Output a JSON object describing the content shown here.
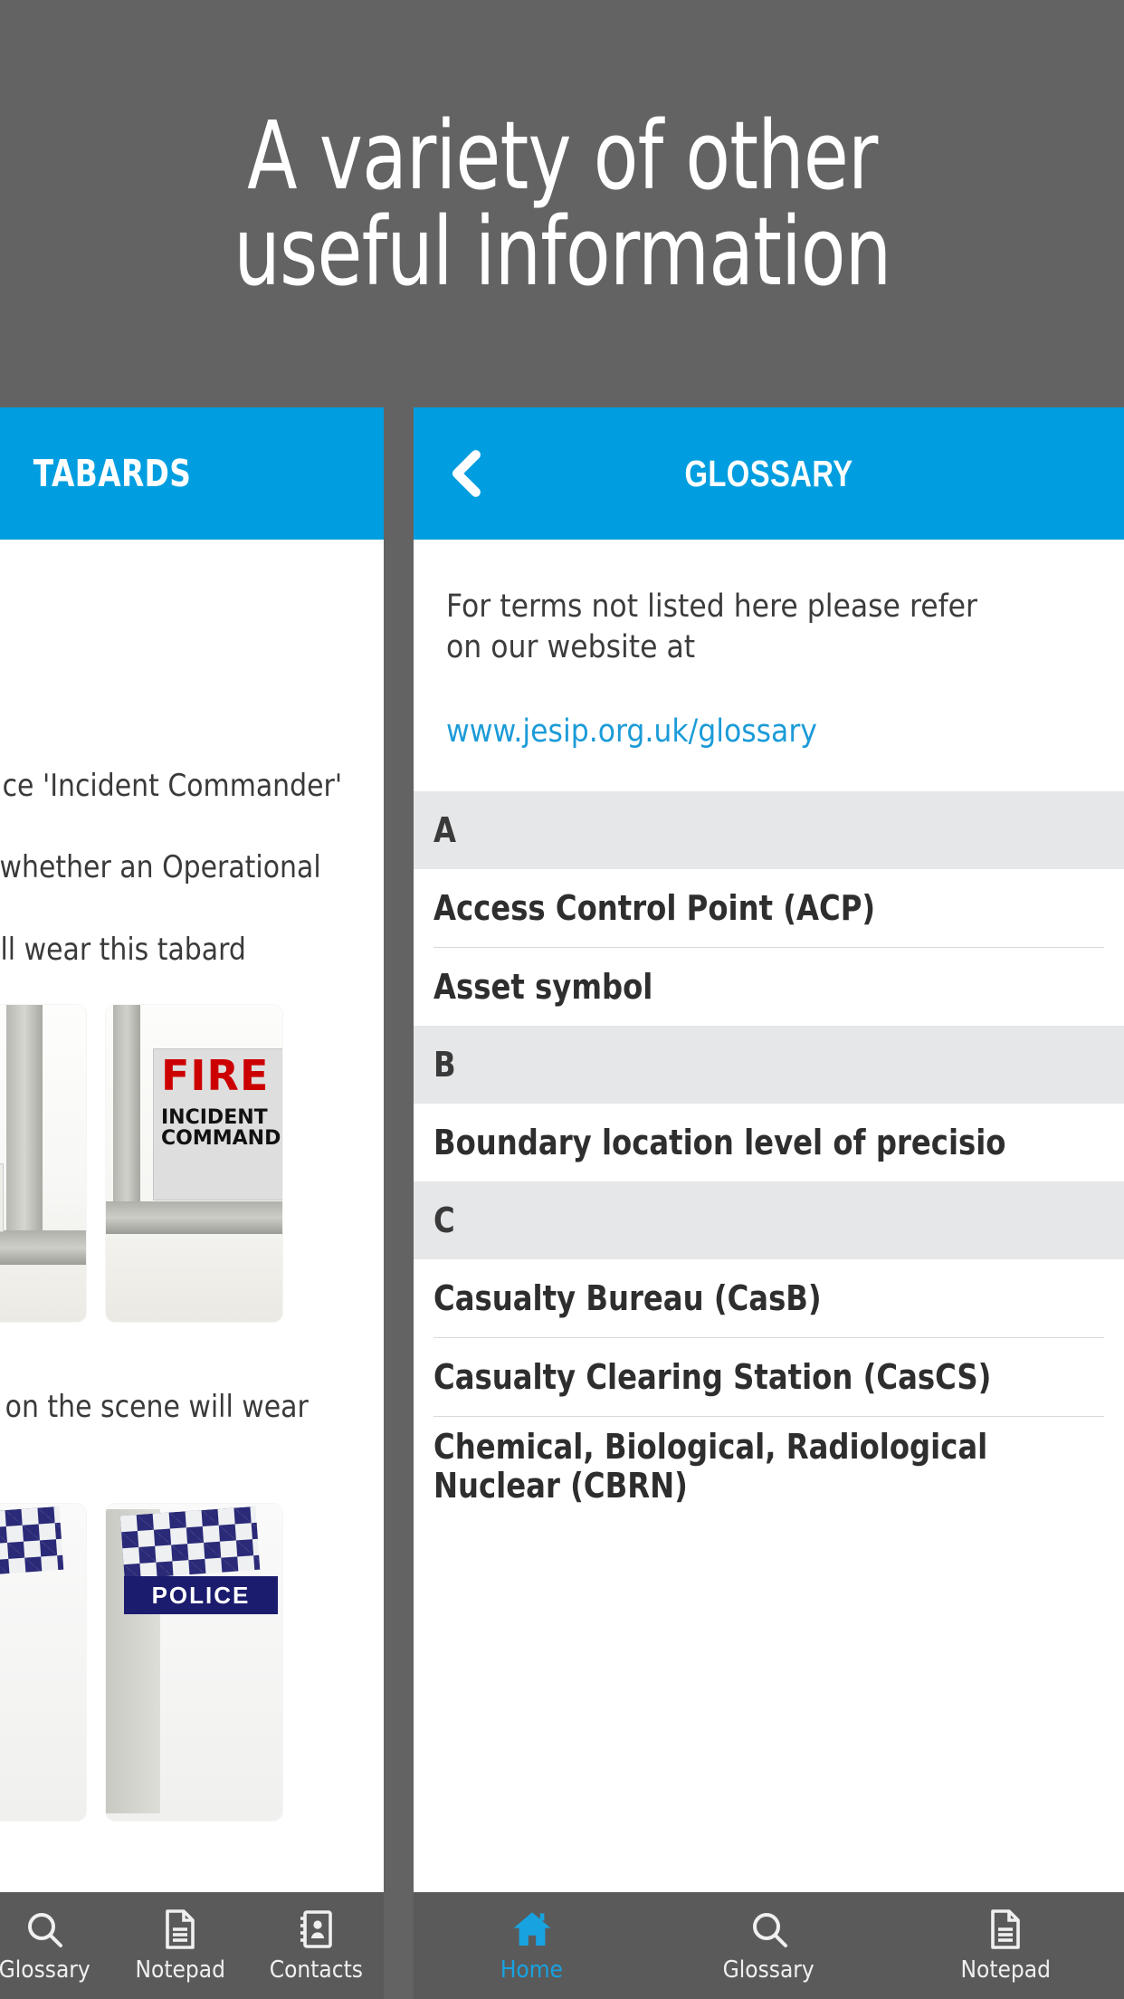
{
  "headline": "A variety of other\nuseful information",
  "colors": {
    "background": "#636363",
    "accent_blue": "#009ee0",
    "link_blue": "#1b9bd8",
    "section_header_gray": "#e6e7e8",
    "nav_bar_gray": "#5a5a5a",
    "active_nav": "#18a3e0"
  },
  "left_panel": {
    "header_title": "TABARDS",
    "paragraph_1": "ue Service 'Incident Commander' on\npective whether an Operational or\nnder, will wear this tabard",
    "paragraph_2": "mander on the scene will wear this",
    "tabard_images": [
      {
        "name": "fire-incident-commander-tabard-back",
        "label_top": "FIRE",
        "label_body": "INCIDENT\nCOMMANDER"
      },
      {
        "name": "fire-incident-commander-tabard-front",
        "label_top": "FIRE",
        "label_body": "INCIDENT\nCOMMANDER"
      },
      {
        "name": "police-tabard-left",
        "label_body": "POLICE"
      },
      {
        "name": "police-tabard-right",
        "label_body": "POLICE"
      }
    ],
    "nav": {
      "items": [
        {
          "label": "Glossary",
          "icon": "search-icon",
          "active": false
        },
        {
          "label": "Notepad",
          "icon": "document-icon",
          "active": false
        },
        {
          "label": "Contacts",
          "icon": "contacts-book-icon",
          "active": false
        }
      ]
    }
  },
  "right_panel": {
    "header_title": "GLOSSARY",
    "back_icon": "chevron-left-icon",
    "intro_text": "For terms not listed here please refer\non our website at",
    "intro_link": "www.jesip.org.uk/glossary",
    "glossary": [
      {
        "letter": "A",
        "terms": [
          "Access Control Point (ACP)",
          "Asset symbol"
        ]
      },
      {
        "letter": "B",
        "terms": [
          "Boundary location level of precisio"
        ]
      },
      {
        "letter": "C",
        "terms": [
          "Casualty Bureau (CasB)",
          "Casualty Clearing Station (CasCS)",
          "Chemical, Biological, Radiological\nNuclear (CBRN)"
        ]
      }
    ],
    "nav": {
      "items": [
        {
          "label": "Home",
          "icon": "home-icon",
          "active": true
        },
        {
          "label": "Glossary",
          "icon": "search-icon",
          "active": false
        },
        {
          "label": "Notepad",
          "icon": "document-icon",
          "active": false
        }
      ]
    }
  }
}
